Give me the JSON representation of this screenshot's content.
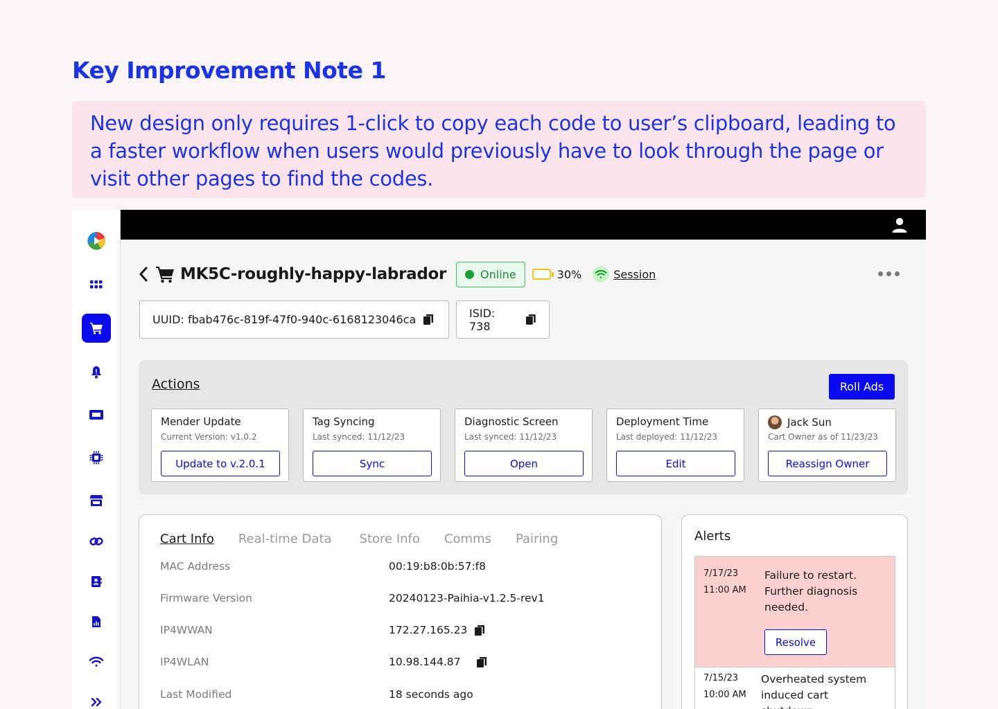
{
  "heading": "Key Improvement Note 1",
  "note": "New design only requires 1-click to copy each code to user’s clipboard, leading to a faster workflow when users would previously have to look through the page or visit other pages to find the codes.",
  "device": {
    "name": "MK5C-roughly-happy-labrador",
    "status": "Online",
    "battery": "30%",
    "session": "Session"
  },
  "codes": {
    "uuid": "UUID: fbab476c-819f-47f0-940c-6168123046ca",
    "isid": "ISID: 738"
  },
  "actions": {
    "title": "Actions",
    "roll_ads": "Roll Ads",
    "cards": [
      {
        "title": "Mender Update",
        "sub": "Current Version: v1.0.2",
        "button": "Update to v.2.0.1"
      },
      {
        "title": "Tag Syncing",
        "sub": "Last synced: 11/12/23",
        "button": "Sync"
      },
      {
        "title": "Diagnostic Screen",
        "sub": "Last synced: 11/12/23",
        "button": "Open"
      },
      {
        "title": "Deployment Time",
        "sub": "Last deployed: 11/12/23",
        "button": "Edit"
      },
      {
        "title": "Jack Sun",
        "sub": "Cart Owner as of 11/23/23",
        "button": "Reassign Owner"
      }
    ]
  },
  "info": {
    "tabs": [
      "Cart Info",
      "Real-time Data",
      "Store Info",
      "Comms",
      "Pairing"
    ],
    "rows": [
      {
        "label": "MAC Address",
        "value": "00:19:b8:0b:57:f8"
      },
      {
        "label": "Firmware Version",
        "value": "20240123-Paihia-v1.2.5-rev1"
      },
      {
        "label": "IP4WWAN",
        "value": "172.27.165.23"
      },
      {
        "label": "IP4WLAN",
        "value": "10.98.144.87"
      },
      {
        "label": "Last Modified",
        "value": "18 seconds ago"
      }
    ]
  },
  "alerts": {
    "title": "Alerts",
    "items": [
      {
        "date": "7/17/23",
        "time": "11:00 AM",
        "message": "Failure to restart. Further diagnosis needed.",
        "button": "Resolve"
      },
      {
        "date": "7/15/23",
        "time": "10:00 AM",
        "message": "Overheated system induced cart shutdown"
      }
    ]
  },
  "colors": {
    "accent": "#0a0af0",
    "heading": "#1a33e6",
    "note_bg": "#fce4ec",
    "online": "#1e9e3a",
    "alert_bg": "#fdd0d0"
  }
}
